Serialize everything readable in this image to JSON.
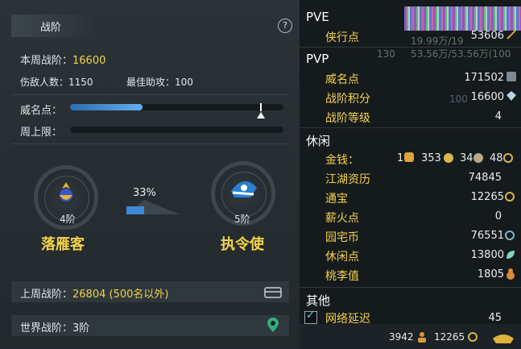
{
  "left": {
    "header_title": "战阶",
    "help": "?",
    "weekly_rank_label": "本周战阶：",
    "weekly_rank_value": "16600",
    "kills_label": "伤敌人数：",
    "kills_value": "1150",
    "assist_label": "最佳助攻：",
    "assist_value": "100",
    "prestige_label": "威名点：",
    "weekly_cap_label": "周上限：",
    "current_rank": {
      "tier": "4阶",
      "name": "落雁客"
    },
    "next_rank": {
      "tier": "5阶",
      "name": "执令使"
    },
    "progress_percent": "33%",
    "last_week_label": "上周战阶：",
    "last_week_value": "26804 (500名以外)",
    "world_rank_label": "世界战阶：",
    "world_rank_value": "3阶"
  },
  "right": {
    "pve_title": "PVE",
    "pve": [
      {
        "label": "侠行点",
        "value": "53606"
      }
    ],
    "pvp_title": "PVP",
    "pvp": [
      {
        "label": "威名点",
        "value": "171502"
      },
      {
        "label": "战阶积分",
        "value": "16600"
      },
      {
        "label": "战阶等级",
        "value": "4"
      }
    ],
    "leisure_title": "休闲",
    "money_label": "金钱：",
    "money_gold": "1",
    "money_silver": "353",
    "money_copper": "34",
    "money_wen": "48",
    "leisure": [
      {
        "label": "江湖资历",
        "value": "74845"
      },
      {
        "label": "通宝",
        "value": "12265"
      },
      {
        "label": "薪火点",
        "value": "0"
      },
      {
        "label": "园宅币",
        "value": "76551"
      },
      {
        "label": "休闲点",
        "value": "13800"
      },
      {
        "label": "桃李值",
        "value": "1805"
      }
    ],
    "other_title": "其他",
    "latency_label": "网络延迟",
    "latency_value": "45",
    "footer_a": "3942",
    "footer_b": "12265",
    "ghost_a": "19.99万/19",
    "ghost_b": "130",
    "ghost_c": "53.56万/53.56万(100"
  }
}
